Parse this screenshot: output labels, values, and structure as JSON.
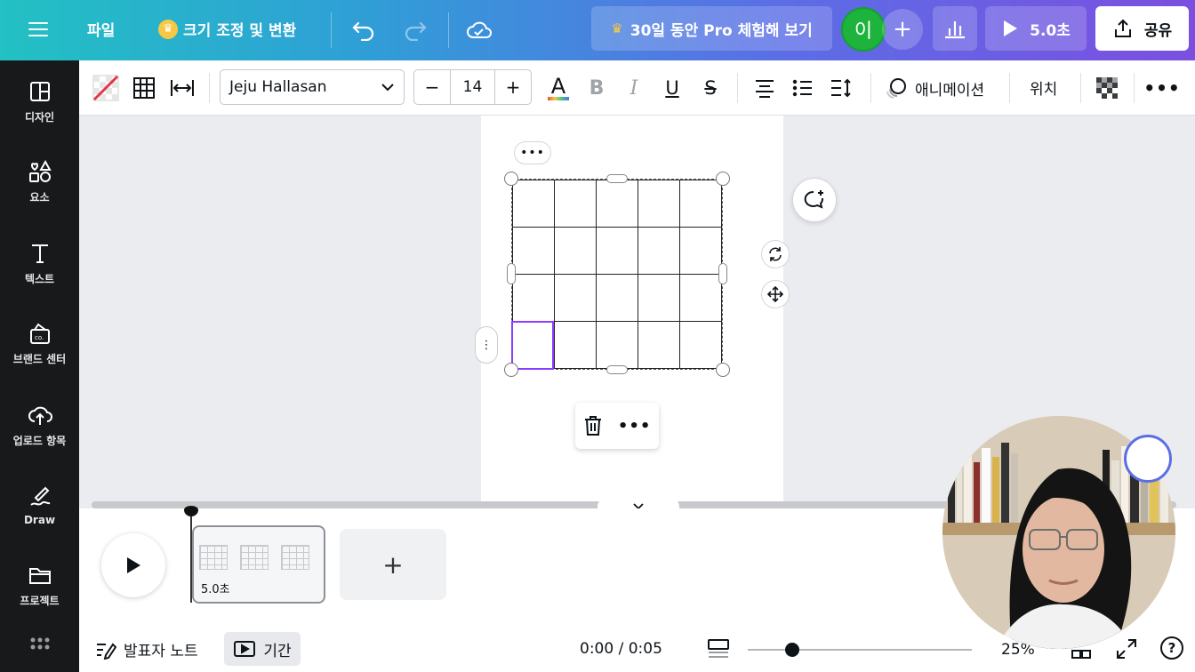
{
  "topbar": {
    "file_label": "파일",
    "resize_label": "크기 조정 및 변환",
    "trial_label": "30일 동안 Pro 체험해 보기",
    "avatar_initial": "이",
    "present_duration": "5.0초",
    "share_label": "공유",
    "icons": [
      "menu-icon",
      "crown-icon",
      "undo-icon",
      "redo-icon",
      "cloud-saved-icon",
      "insights-icon",
      "play-icon",
      "share-icon"
    ]
  },
  "sidebar": {
    "items": [
      {
        "label": "디자인",
        "icon": "design-icon"
      },
      {
        "label": "요소",
        "icon": "elements-icon"
      },
      {
        "label": "텍스트",
        "icon": "text-icon"
      },
      {
        "label": "브랜드 센터",
        "icon": "brand-icon"
      },
      {
        "label": "업로드 항목",
        "icon": "upload-icon"
      },
      {
        "label": "Draw",
        "icon": "draw-icon"
      },
      {
        "label": "프로젝트",
        "icon": "folder-icon"
      }
    ]
  },
  "toolbar": {
    "font_name": "Jeju Hallasan",
    "font_size": "14",
    "animate_label": "애니메이션",
    "position_label": "위치",
    "text_color_bar": "#e8553a"
  },
  "canvas": {
    "table_rows": 4,
    "table_cols": 5,
    "selection_color": "#8b3dff"
  },
  "timeline": {
    "clip_duration": "5.0초",
    "notes_label": "발표자 노트",
    "duration_label": "기간",
    "time_readout": "0:00 / 0:05",
    "zoom_percent": "25%",
    "zoom_level": 0.2
  },
  "colors": {
    "topbar_start": "#22c1c3",
    "topbar_end": "#7b4fe0",
    "sidebar_bg": "#18191b",
    "avatar_green": "#1db33c"
  }
}
